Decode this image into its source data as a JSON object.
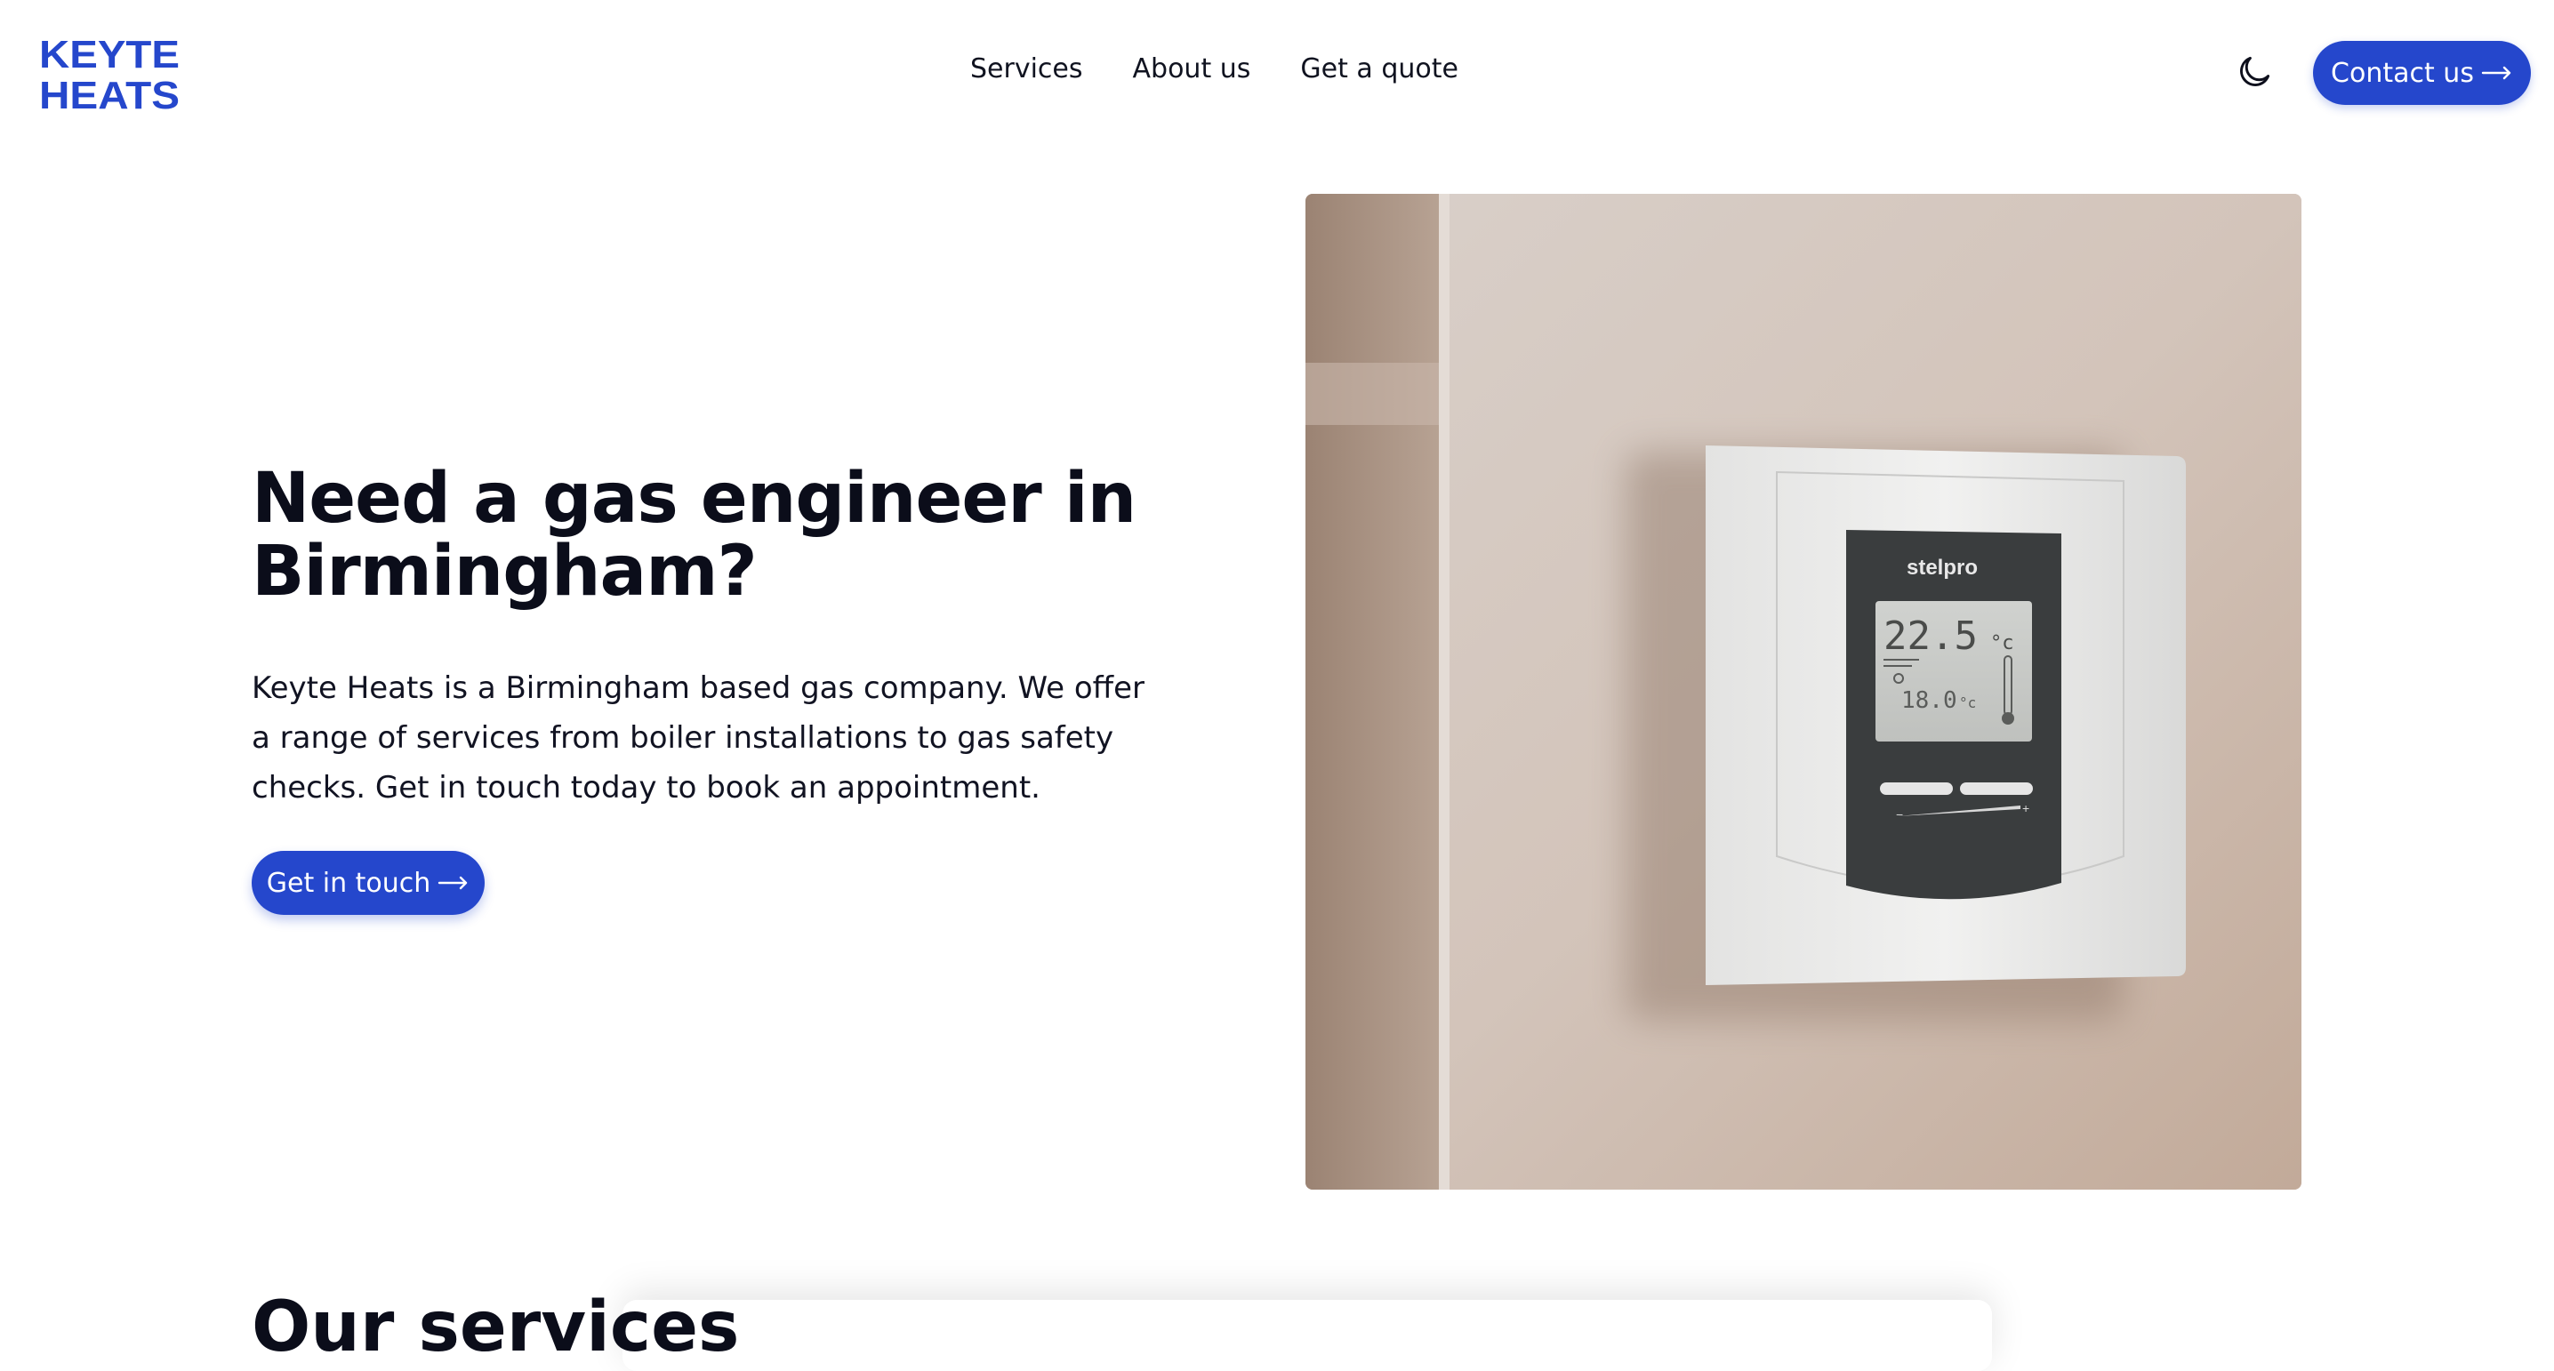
{
  "brand": {
    "line1": "KEYTE",
    "line2": "HEATS",
    "color": "#2547cc"
  },
  "nav": {
    "items": [
      "Services",
      "About us",
      "Get a quote"
    ]
  },
  "header": {
    "contact_label": "Contact us",
    "theme_icon": "moon-icon"
  },
  "hero": {
    "title": "Need a gas engineer in Birmingham?",
    "text": "Keyte Heats is a Birmingham based gas company. We offer a range of services from boiler installations to gas safety checks. Get in touch today to book an appointment.",
    "cta_label": "Get in touch",
    "image": {
      "subject": "wall-mounted thermostat",
      "brand_text": "stelpro",
      "reading_main": "22.5",
      "reading_main_unit": "°c",
      "reading_set": "18.0",
      "reading_set_unit": "°c"
    }
  },
  "next_section": {
    "title": "Our services"
  },
  "colors": {
    "accent": "#2547cc",
    "text": "#0b0d1a",
    "background": "#ffffff"
  }
}
